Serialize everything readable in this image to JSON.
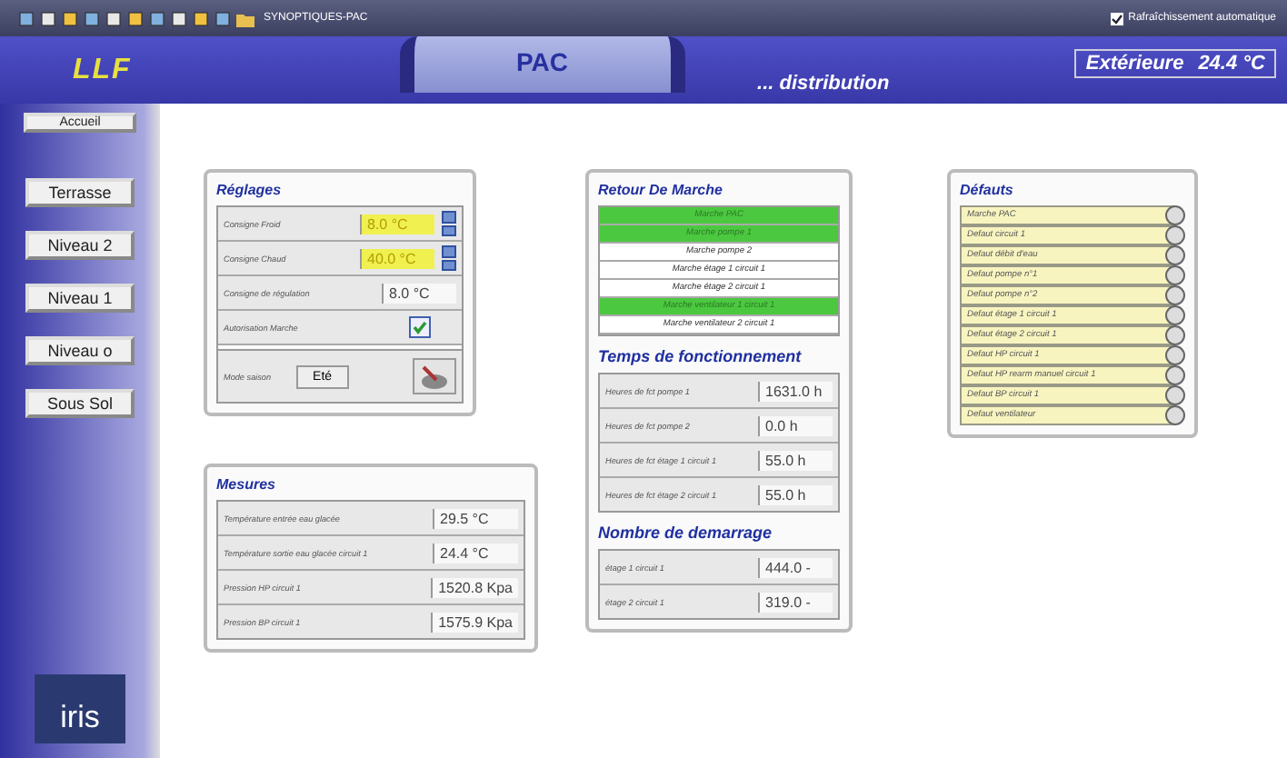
{
  "toolbar": {
    "title": "SYNOPTIQUES-PAC",
    "auto_refresh": {
      "label": "Rafraîchissement automatique",
      "checked": true
    }
  },
  "header": {
    "logo": "LLF",
    "tab": "PAC",
    "subtitle": "... distribution",
    "outdoor": {
      "label": "Extérieure",
      "value": "24.4 °C"
    }
  },
  "sidebar": {
    "items": [
      {
        "label": "Accueil",
        "kind": "small"
      },
      {
        "label": "Terrasse",
        "kind": "large"
      },
      {
        "label": "Niveau 2",
        "kind": "large"
      },
      {
        "label": "Niveau 1",
        "kind": "large"
      },
      {
        "label": "Niveau o",
        "kind": "large"
      },
      {
        "label": "Sous Sol",
        "kind": "large"
      }
    ],
    "logo": "iris"
  },
  "reglages": {
    "title": "Réglages",
    "rows": [
      {
        "kind": "setpoint",
        "label": "Consigne Froid",
        "value": "8.0 °C"
      },
      {
        "kind": "setpoint",
        "label": "Consigne Chaud",
        "value": "40.0 °C"
      },
      {
        "kind": "reading",
        "label": "Consigne de régulation",
        "value": "8.0 °C"
      },
      {
        "kind": "checkbox",
        "label": "Autorisation Marche",
        "checked": true
      },
      {
        "kind": "mode",
        "label": "Mode saison",
        "value": "Eté"
      }
    ]
  },
  "mesures": {
    "title": "Mesures",
    "rows": [
      {
        "label": "Température entrée eau glacée",
        "value": "29.5 °C"
      },
      {
        "label": "Température sortie eau glacée circuit 1",
        "value": "24.4 °C"
      },
      {
        "label": "Pression HP circuit 1",
        "value": "1520.8 Kpa"
      },
      {
        "label": "Pression BP circuit 1",
        "value": "1575.9 Kpa"
      }
    ]
  },
  "retour": {
    "title": "Retour De Marche",
    "items": [
      {
        "label": "Marche PAC",
        "on": true
      },
      {
        "label": "Marche pompe 1",
        "on": true
      },
      {
        "label": "Marche pompe 2",
        "on": false
      },
      {
        "label": "Marche étage 1 circuit 1",
        "on": false
      },
      {
        "label": "Marche étage 2 circuit 1",
        "on": false
      },
      {
        "label": "Marche ventilateur 1 circuit 1",
        "on": true
      },
      {
        "label": "Marche ventilateur 2 circuit 1",
        "on": false
      }
    ]
  },
  "temps": {
    "title": "Temps de fonctionnement",
    "rows": [
      {
        "label": "Heures de fct pompe 1",
        "value": "1631.0 h"
      },
      {
        "label": "Heures de fct pompe 2",
        "value": "0.0 h"
      },
      {
        "label": "Heures de fct étage 1 circuit 1",
        "value": "55.0 h"
      },
      {
        "label": "Heures de fct étage 2 circuit 1",
        "value": "55.0 h"
      }
    ]
  },
  "demarrage": {
    "title": "Nombre de demarrage",
    "rows": [
      {
        "label": "étage 1 circuit 1",
        "value": "444.0 -"
      },
      {
        "label": "étage 2 circuit 1",
        "value": "319.0 -"
      }
    ]
  },
  "defauts": {
    "title": "Défauts",
    "items": [
      {
        "label": "Marche PAC",
        "on": false
      },
      {
        "label": "Defaut circuit 1",
        "on": false
      },
      {
        "label": "Defaut débit d'eau",
        "on": false
      },
      {
        "label": "Defaut pompe n°1",
        "on": false
      },
      {
        "label": "Defaut pompe n°2",
        "on": false
      },
      {
        "label": "Defaut étage 1 circuit 1",
        "on": false
      },
      {
        "label": "Defaut étage 2 circuit 1",
        "on": false
      },
      {
        "label": "Defaut HP circuit 1",
        "on": false
      },
      {
        "label": "Defaut HP rearm manuel circuit 1",
        "on": false
      },
      {
        "label": "Defaut BP circuit 1",
        "on": false
      },
      {
        "label": "Defaut ventilateur",
        "on": false
      }
    ]
  }
}
